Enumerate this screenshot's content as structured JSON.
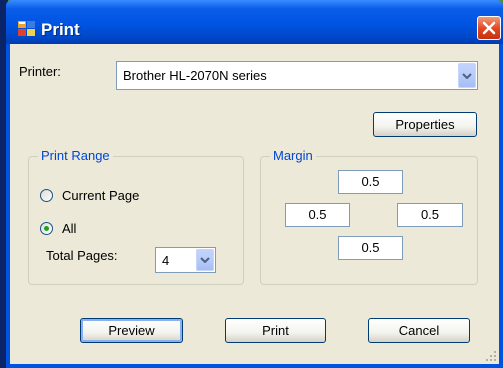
{
  "window": {
    "title": "Print"
  },
  "printer": {
    "label": "Printer:",
    "selected": "Brother HL-2070N series"
  },
  "properties_button": "Properties",
  "print_range": {
    "title": "Print Range",
    "options": [
      {
        "label": "Current Page",
        "checked": false
      },
      {
        "label": "All",
        "checked": true
      }
    ],
    "total_pages_label": "Total Pages:",
    "total_pages_value": "4"
  },
  "margin": {
    "title": "Margin",
    "top": "0.5",
    "left": "0.5",
    "right": "0.5",
    "bottom": "0.5"
  },
  "buttons": {
    "preview": "Preview",
    "print": "Print",
    "cancel": "Cancel"
  },
  "icons": {
    "title": "printer-app-icon",
    "close": "close-icon",
    "dropdown": "chevron-down-icon"
  },
  "colors": {
    "title_bar": "#0054e3",
    "client": "#ece9d8",
    "group_title": "#0046d5",
    "close": "#e0451e"
  }
}
